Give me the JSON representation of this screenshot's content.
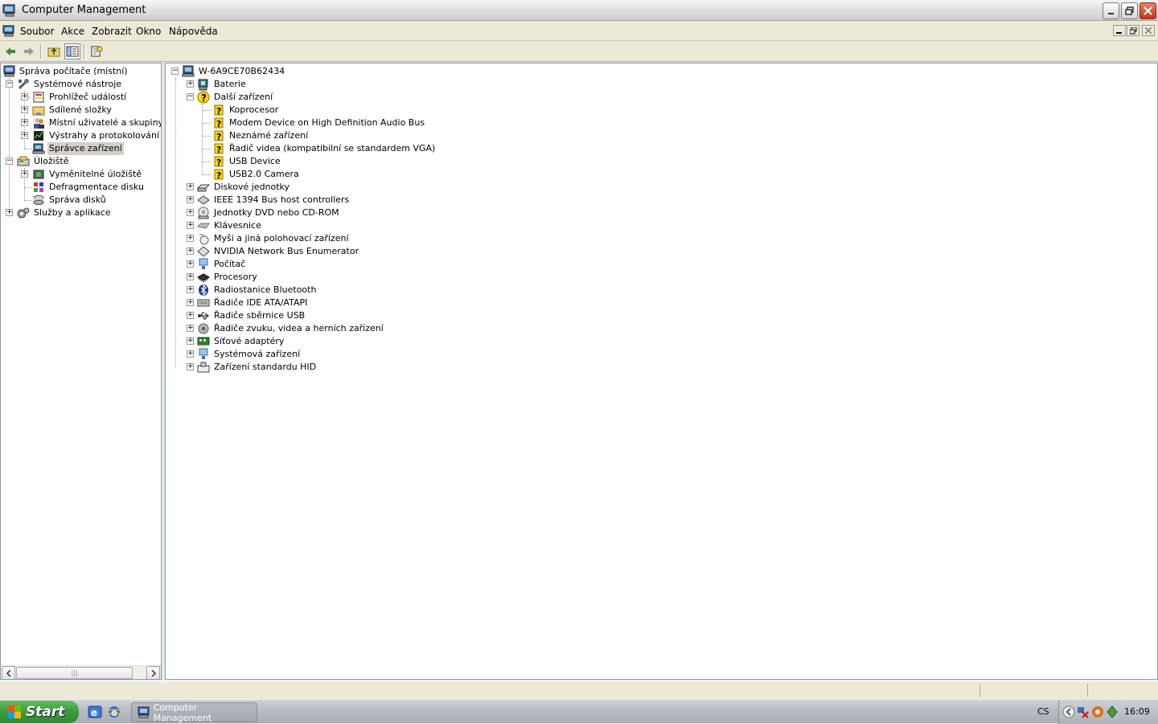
{
  "window": {
    "title": "Computer Management"
  },
  "menu": {
    "items": [
      "Soubor",
      "Akce",
      "Zobrazit",
      "Okno",
      "Nápověda"
    ]
  },
  "left_tree": {
    "root": "Správa počítače (místní)",
    "system_tools": "Systémové nástroje",
    "event_viewer": "Prohlížeč událostí",
    "shared_folders": "Sdílené složky",
    "local_users": "Místní uživatelé a skupiny",
    "perf_logs": "Výstrahy a protokolování vý",
    "device_manager": "Správce zařízení",
    "storage": "Úložiště",
    "removable": "Vyměnitelné úložiště",
    "defrag": "Defragmentace disku",
    "disk_mgmt": "Správa disků",
    "services": "Služby a aplikace"
  },
  "right_tree": {
    "computer": "W-6A9CE70B62434",
    "categories": [
      {
        "label": "Baterie",
        "icon": "battery-icon"
      },
      {
        "label": "Další zařízení",
        "icon": "unknown-device-icon",
        "expanded": true,
        "children": [
          "Koprocesor",
          "Modem Device on High Definition Audio Bus",
          "Neznámé zařízení",
          "Řadič videa (kompatibilní se standardem VGA)",
          "USB Device",
          "USB2.0 Camera"
        ]
      },
      {
        "label": "Diskové jednotky",
        "icon": "disk-drive-icon"
      },
      {
        "label": "IEEE 1394 Bus host controllers",
        "icon": "firewire-icon"
      },
      {
        "label": "Jednotky DVD nebo CD-ROM",
        "icon": "cdrom-icon"
      },
      {
        "label": "Klávesnice",
        "icon": "keyboard-icon"
      },
      {
        "label": "Myši a jiná polohovací zařízení",
        "icon": "mouse-icon"
      },
      {
        "label": "NVIDIA Network Bus Enumerator",
        "icon": "network-bus-icon"
      },
      {
        "label": "Počítač",
        "icon": "computer-icon"
      },
      {
        "label": "Procesory",
        "icon": "processor-icon"
      },
      {
        "label": "Radiostanice Bluetooth",
        "icon": "bluetooth-icon"
      },
      {
        "label": "Řadiče IDE ATA/ATAPI",
        "icon": "ide-controller-icon"
      },
      {
        "label": "Řadiče sběrnice USB",
        "icon": "usb-icon"
      },
      {
        "label": "Řadiče zvuku, videa a herních zařízení",
        "icon": "sound-icon"
      },
      {
        "label": "Síťové adaptéry",
        "icon": "network-adapter-icon"
      },
      {
        "label": "Systémová zařízení",
        "icon": "system-device-icon"
      },
      {
        "label": "Zařízení standardu HID",
        "icon": "hid-icon"
      }
    ]
  },
  "taskbar": {
    "start_label": "Start",
    "task_label": "Computer Management",
    "language": "CS",
    "clock": "16:09"
  },
  "colors": {
    "selection": "#d4d0c8",
    "warning_yellow": "#ffd800",
    "start_green": "#3a9a3a"
  }
}
